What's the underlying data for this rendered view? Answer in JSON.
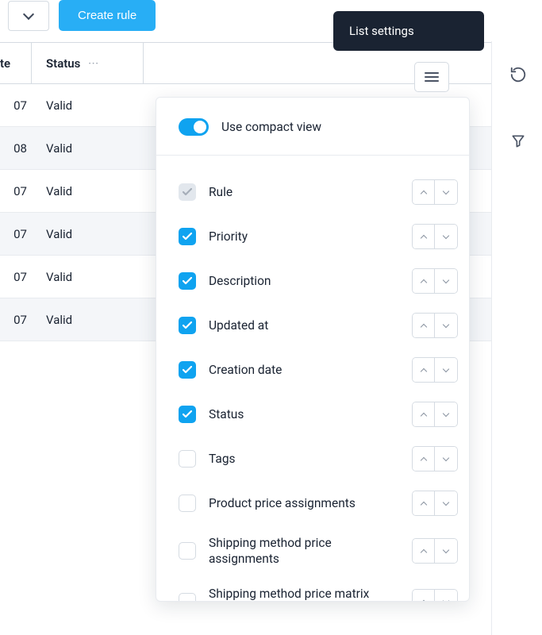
{
  "toolbar": {
    "create_rule_label": "Create rule"
  },
  "tooltip": {
    "list_settings": "List settings"
  },
  "table": {
    "headers": {
      "date_suffix": "te",
      "status": "Status"
    },
    "rows": [
      {
        "date_suffix": "07",
        "status": "Valid",
        "alt": false
      },
      {
        "date_suffix": "08",
        "status": "Valid",
        "alt": true
      },
      {
        "date_suffix": "07",
        "status": "Valid",
        "alt": false
      },
      {
        "date_suffix": "07",
        "status": "Valid",
        "alt": true
      },
      {
        "date_suffix": "07",
        "status": "Valid",
        "alt": false
      },
      {
        "date_suffix": "07",
        "status": "Valid",
        "alt": true
      }
    ]
  },
  "popover": {
    "compact_view_label": "Use compact view",
    "compact_view_on": true,
    "columns": [
      {
        "label": "Rule",
        "state": "disabled"
      },
      {
        "label": "Priority",
        "state": "checked"
      },
      {
        "label": "Description",
        "state": "checked"
      },
      {
        "label": "Updated at",
        "state": "checked"
      },
      {
        "label": "Creation date",
        "state": "checked"
      },
      {
        "label": "Status",
        "state": "checked"
      },
      {
        "label": "Tags",
        "state": "unchecked"
      },
      {
        "label": "Product price assignments",
        "state": "unchecked"
      },
      {
        "label": "Shipping method price assignments",
        "state": "unchecked"
      },
      {
        "label": "Shipping method price matrix assignments",
        "state": "unchecked"
      }
    ]
  }
}
